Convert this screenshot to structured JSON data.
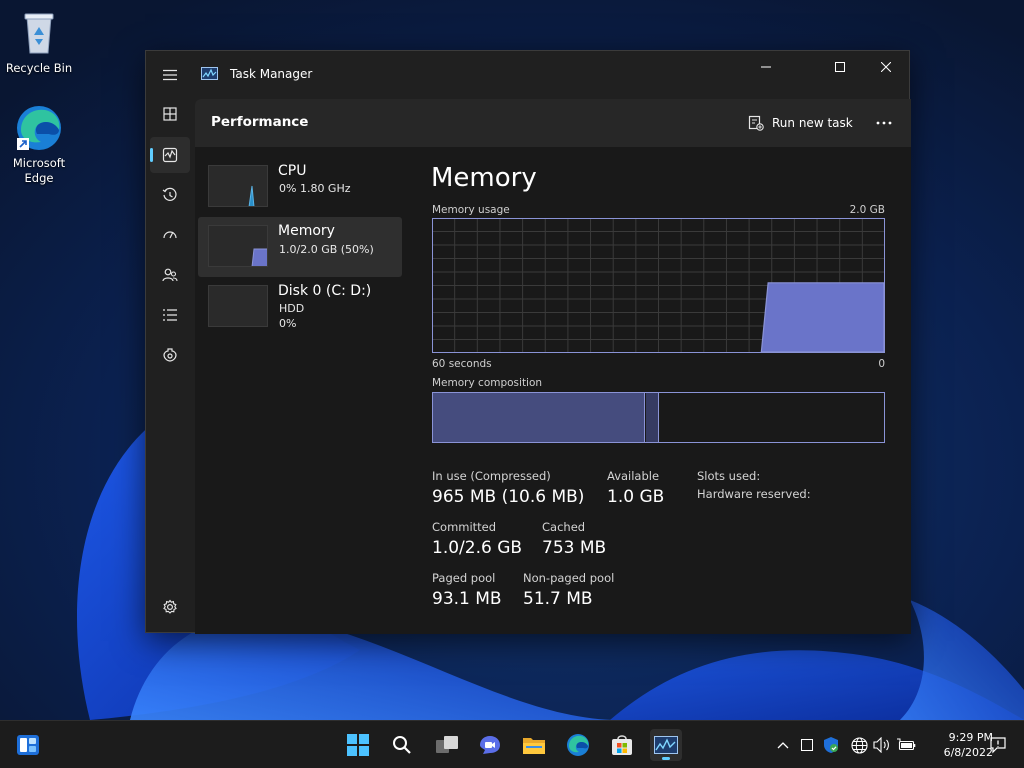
{
  "desktop": {
    "icons": [
      {
        "label": "Recycle Bin",
        "icon": "recycle-bin-icon"
      },
      {
        "label": "Microsoft Edge",
        "icon": "edge-icon"
      }
    ]
  },
  "window": {
    "title": "Task Manager",
    "controls": [
      "minimize-icon",
      "maximize-icon",
      "close-icon"
    ]
  },
  "nav": {
    "items": [
      {
        "name": "hamburger-menu-icon"
      },
      {
        "name": "processes-icon"
      },
      {
        "name": "performance-icon",
        "active": true
      },
      {
        "name": "app-history-icon"
      },
      {
        "name": "startup-apps-icon"
      },
      {
        "name": "users-icon"
      },
      {
        "name": "details-icon"
      },
      {
        "name": "services-icon"
      },
      {
        "name": "settings-icon"
      }
    ]
  },
  "header": {
    "page_title": "Performance",
    "run_new_task": "Run new task",
    "more_icon": "more-dots-icon"
  },
  "devices": [
    {
      "name": "CPU",
      "sub1": "0% 1.80 GHz",
      "sub2": ""
    },
    {
      "name": "Memory",
      "sub1": "1.0/2.0 GB (50%)",
      "sub2": "",
      "selected": true
    },
    {
      "name": "Disk 0 (C: D:)",
      "sub1": "HDD",
      "sub2": "0%"
    }
  ],
  "detail": {
    "title": "Memory",
    "usage_label": "Memory usage",
    "usage_max": "2.0 GB",
    "time_label": "60 seconds",
    "time_end": "0",
    "composition_label": "Memory composition",
    "composition": {
      "in_use_fraction": 0.47,
      "modified_fraction": 0.03
    },
    "usage_level_fraction": 0.5,
    "stats": {
      "in_use_label": "In use (Compressed)",
      "in_use_value": "965 MB (10.6 MB)",
      "available_label": "Available",
      "available_value": "1.0 GB",
      "slots_label": "Slots used:",
      "hw_reserved_label": "Hardware reserved:",
      "committed_label": "Committed",
      "committed_value": "1.0/2.6 GB",
      "cached_label": "Cached",
      "cached_value": "753 MB",
      "paged_label": "Paged pool",
      "paged_value": "93.1 MB",
      "nonpaged_label": "Non-paged pool",
      "nonpaged_value": "51.7 MB"
    }
  },
  "colors": {
    "accent": "#60cdff",
    "memory_fill": "#6a74c9",
    "memory_line": "#8a93d6"
  },
  "taskbar": {
    "apps": [
      "widgets-icon",
      "start-icon",
      "search-icon",
      "task-view-icon",
      "chat-icon",
      "file-explorer-icon",
      "edge-icon",
      "store-icon",
      "task-manager-icon"
    ],
    "tray": [
      "chevron-up-icon",
      "notification-box-icon",
      "security-icon",
      "network-icon",
      "volume-icon",
      "battery-icon",
      "feedback-icon"
    ],
    "time": "9:29 PM",
    "date": "6/8/2022"
  }
}
